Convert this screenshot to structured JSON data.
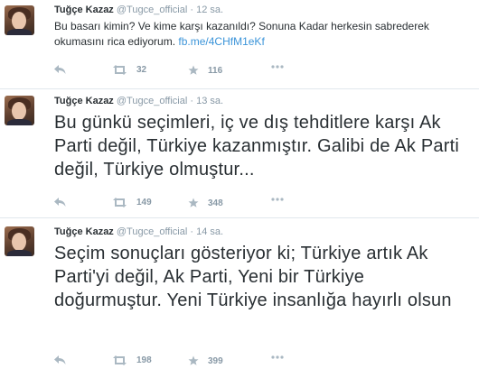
{
  "tweets": [
    {
      "name": "Tuğçe Kazaz",
      "handle": "@Tugce_official",
      "dot": "·",
      "time": "12 sa.",
      "text": "Bu basarı kimin? Ve kime karşı kazanıldı?  Sonuna Kadar herkesin sabrederek okumasını rica ediyorum.",
      "link": "fb.me/4CHfM1eKf",
      "retweets": "32",
      "favorites": "116"
    },
    {
      "name": "Tuğçe Kazaz",
      "handle": "@Tugce_official",
      "dot": "·",
      "time": "13 sa.",
      "text": "Bu günkü seçimleri, iç ve dış tehditlere karşı Ak Parti değil, Türkiye kazanmıştır. Galibi de Ak Parti değil, Türkiye olmuştur...",
      "retweets": "149",
      "favorites": "348"
    },
    {
      "name": "Tuğçe Kazaz",
      "handle": "@Tugce_official",
      "dot": "·",
      "time": "14 sa.",
      "text": "Seçim sonuçları gösteriyor ki; Türkiye artık Ak Parti'yi değil, Ak Parti, Yeni bir Türkiye doğurmuştur. Yeni Türkiye insanlığa hayırlı olsun",
      "retweets": "198",
      "favorites": "399"
    }
  ],
  "icons": {
    "reply": "reply-icon",
    "retweet": "retweet-icon",
    "favorite": "favorite-star-icon",
    "more": "more-dots-icon"
  },
  "colors": {
    "name": "#292f33",
    "meta": "#8899a6",
    "link": "#3b94d9",
    "divider": "#e1e8ed"
  }
}
